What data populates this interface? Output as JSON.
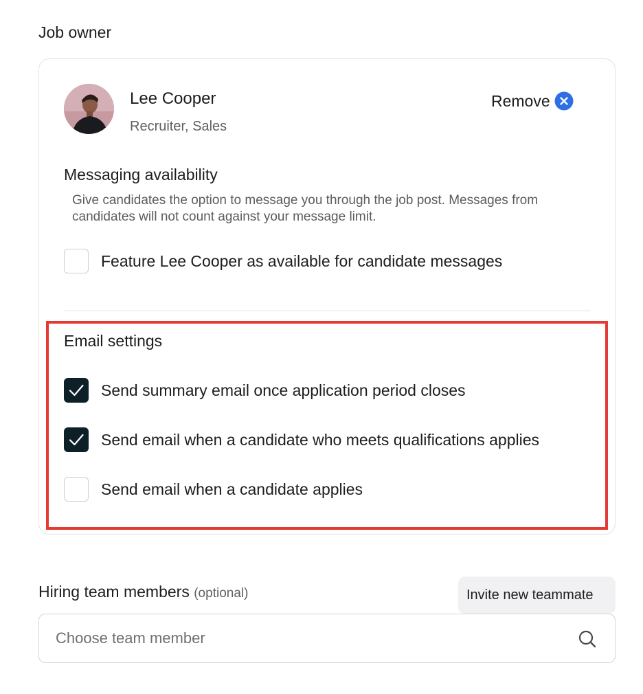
{
  "job_owner": {
    "section_title": "Job owner",
    "name": "Lee Cooper",
    "role": "Recruiter, Sales",
    "remove_label": "Remove",
    "remove_icon": "close-circle-icon",
    "accent_color": "#2f6fe4"
  },
  "messaging": {
    "title": "Messaging availability",
    "description": "Give candidates the option to message you through the job post. Messages from candidates will not count against your message limit.",
    "option": {
      "label": "Feature Lee Cooper as available for candidate messages",
      "checked": false
    }
  },
  "email_settings": {
    "title": "Email settings",
    "options": [
      {
        "label": "Send summary email once application period closes",
        "checked": true
      },
      {
        "label": "Send email when a candidate who meets qualifications applies",
        "checked": true
      },
      {
        "label": "Send email when a candidate applies",
        "checked": false
      }
    ],
    "highlight_color": "#e53935"
  },
  "hiring_team": {
    "title": "Hiring team members",
    "optional_label": "(optional)",
    "invite_label": "Invite new teammate",
    "search_placeholder": "Choose team member",
    "search_icon": "search-icon"
  }
}
